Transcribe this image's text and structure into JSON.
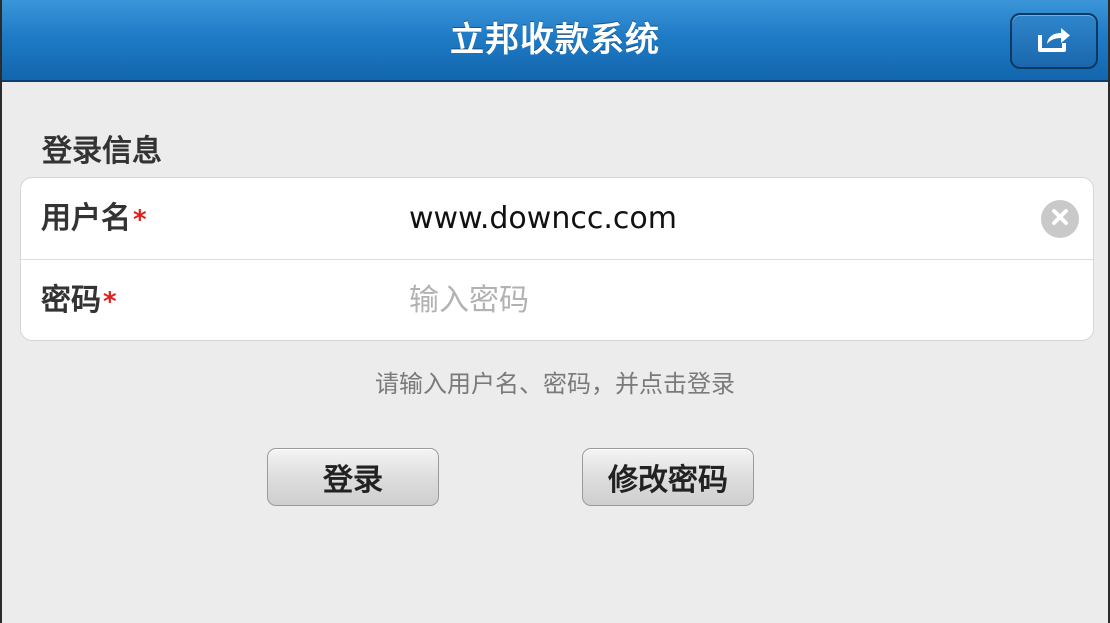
{
  "header": {
    "title": "立邦收款系统",
    "share_icon": "share-icon"
  },
  "section": {
    "title": "登录信息"
  },
  "form": {
    "username": {
      "label": "用户名",
      "required_mark": "*",
      "value": "www.downcc.com",
      "clear_icon": "clear-icon"
    },
    "password": {
      "label": "密码",
      "required_mark": "*",
      "value": "",
      "placeholder": "输入密码"
    }
  },
  "hint": "请输入用户名、密码，并点击登录",
  "buttons": {
    "login": "登录",
    "change_password": "修改密码"
  },
  "colors": {
    "header_blue": "#1f7bc6",
    "required_red": "#e0201b",
    "background": "#ececec"
  }
}
